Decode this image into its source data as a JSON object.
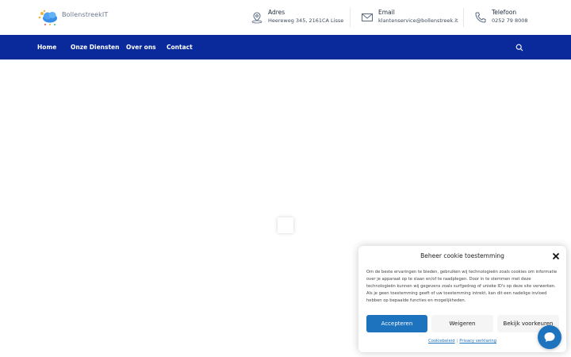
{
  "header": {
    "logo_text": "BollenstreekIT",
    "address": {
      "label": "Adres",
      "value": "Heereweg 345, 2161CA Lisse"
    },
    "email": {
      "label": "Email",
      "value": "klantenservice@bollenstreek.it"
    },
    "phone": {
      "label": "Telefoon",
      "value": "0252 79 8008"
    }
  },
  "nav": {
    "items": [
      {
        "label": "Home"
      },
      {
        "label": "Onze Diensten"
      },
      {
        "label": "Over ons"
      },
      {
        "label": "Contact"
      }
    ]
  },
  "cookie": {
    "title": "Beheer cookie toestemming",
    "body": "Om de beste ervaringen te bieden, gebruiken wij technologieën zoals cookies om informatie over je apparaat op te slaan en/of te raadplegen. Door in te stemmen met deze technologieën kunnen wij gegevens zoals surfgedrag of unieke ID's op deze site verwerken. Als je geen toestemming geeft of uw toestemming intrekt, kan dit een nadelige invloed hebben op bepaalde functies en mogelijkheden.",
    "accept": "Accepteren",
    "deny": "Weigeren",
    "prefs": "Bekijk voorkeuren",
    "link_policy": "Cookiebeleid",
    "link_privacy": "Privacy verklaring"
  },
  "colors": {
    "nav_bg": "#0a2a9c",
    "accent": "#1e73be"
  }
}
